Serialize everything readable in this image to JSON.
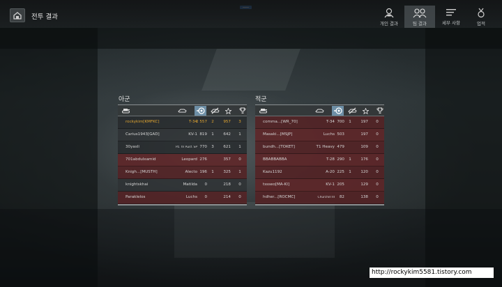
{
  "page_title": "전투 결과",
  "nav": {
    "personal": "개인 결과",
    "team": "팀 결과",
    "details": "세부 사항",
    "achievements": "업적"
  },
  "ally": {
    "title": "아군",
    "rows": [
      {
        "name": "rockykim[KMFKC]",
        "tank": "T-34",
        "damage": "2 557",
        "frags": "2",
        "exp": "957",
        "score": "3",
        "highlight": "self"
      },
      {
        "name": "Carius1943[GAD]",
        "tank": "KV-1",
        "damage": "819",
        "frags": "1",
        "exp": "642",
        "score": "1",
        "highlight": ""
      },
      {
        "name": "30yasli",
        "tank": "Pz. IV Ausf. SP",
        "damage": "770",
        "frags": "3",
        "exp": "621",
        "score": "1",
        "highlight": ""
      },
      {
        "name": "701abdulxamid",
        "tank": "Leopard",
        "damage": "276",
        "frags": "",
        "exp": "357",
        "score": "0",
        "highlight": "dead"
      },
      {
        "name": "Knigh...[MUSTH]",
        "tank": "Alecto",
        "damage": "196",
        "frags": "1",
        "exp": "325",
        "score": "1",
        "highlight": "dead"
      },
      {
        "name": "knightskhai",
        "tank": "Matilda",
        "damage": "0",
        "frags": "",
        "exp": "218",
        "score": "0",
        "highlight": ""
      },
      {
        "name": "Paraklelos",
        "tank": "Luchs",
        "damage": "0",
        "frags": "",
        "exp": "214",
        "score": "0",
        "highlight": "dead"
      }
    ]
  },
  "enemy": {
    "title": "적군",
    "rows": [
      {
        "name": "comma...[WR_70]",
        "tank": "T-34",
        "damage": "700",
        "frags": "1",
        "exp": "197",
        "score": "0",
        "highlight": "dead"
      },
      {
        "name": "Masaki...[MSJP]",
        "tank": "Luchs",
        "damage": "503",
        "frags": "",
        "exp": "197",
        "score": "0",
        "highlight": "dead"
      },
      {
        "name": "bundh...[TOKET]",
        "tank": "T1 Heavy",
        "damage": "479",
        "frags": "",
        "exp": "109",
        "score": "0",
        "highlight": "dead"
      },
      {
        "name": "BBABBABBA",
        "tank": "T-28",
        "damage": "290",
        "frags": "1",
        "exp": "176",
        "score": "0",
        "highlight": "dead"
      },
      {
        "name": "Kazu1192",
        "tank": "A-20",
        "damage": "225",
        "frags": "1",
        "exp": "120",
        "score": "0",
        "highlight": "dead"
      },
      {
        "name": "tssseo[MA-KI]",
        "tank": "KV-1",
        "damage": "205",
        "frags": "",
        "exp": "129",
        "score": "0",
        "highlight": "dead"
      },
      {
        "name": "hdher...[ROCMC]",
        "tank": "Churchill III",
        "damage": "82",
        "frags": "",
        "exp": "138",
        "score": "0",
        "highlight": "dead"
      }
    ]
  },
  "header_icons": [
    "tank-icon",
    "vehicle-type-icon",
    "damage-icon",
    "kills-icon",
    "star-icon",
    "trophy-icon"
  ],
  "colors": {
    "self_text": "#e0a530",
    "dead_row": "#5c2426",
    "active_sort": "#6e8fa6"
  },
  "watermark": "http://rockykim5581.tistory.com"
}
